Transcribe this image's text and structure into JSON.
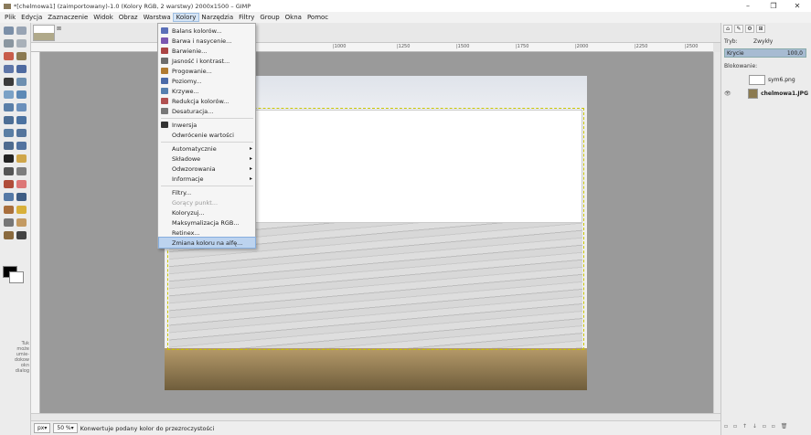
{
  "window": {
    "title": "*[chelmowa1] (zaimportowany)-1.0 (Kolory RGB, 2 warstwy) 2000x1500 – GIMP",
    "minimize": "–",
    "maximize": "❐",
    "close": "✕"
  },
  "menubar": [
    "Plik",
    "Edycja",
    "Zaznaczenie",
    "Widok",
    "Obraz",
    "Warstwa",
    "Kolory",
    "Narzędzia",
    "Filtry",
    "Group",
    "Okna",
    "Pomoc"
  ],
  "kolory_menu": [
    {
      "label": "Balans kolorów...",
      "icon": "color-balance-icon",
      "color": "#5a6fb8"
    },
    {
      "label": "Barwa i nasycenie...",
      "icon": "hue-saturation-icon",
      "color": "#7a56b0"
    },
    {
      "label": "Barwienie...",
      "icon": "colorize-icon",
      "color": "#a44"
    },
    {
      "label": "Jasność i kontrast...",
      "icon": "brightness-contrast-icon",
      "color": "#6c6c6c"
    },
    {
      "label": "Progowanie...",
      "icon": "threshold-icon",
      "color": "#b07a30"
    },
    {
      "label": "Poziomy...",
      "icon": "levels-icon",
      "color": "#4a6aa8"
    },
    {
      "label": "Krzywe...",
      "icon": "curves-icon",
      "color": "#5580b0"
    },
    {
      "label": "Redukcja kolorów...",
      "icon": "posterize-icon",
      "color": "#b05050"
    },
    {
      "label": "Desaturacja...",
      "icon": "desaturate-icon",
      "color": "#777"
    },
    {
      "label": "Inwersja",
      "icon": "invert-icon",
      "color": "#333"
    },
    {
      "label": "Odwrócenie wartości",
      "icon": "",
      "color": ""
    },
    {
      "label": "Automatycznie",
      "icon": "",
      "color": "",
      "submenu": true
    },
    {
      "label": "Składowe",
      "icon": "",
      "color": "",
      "submenu": true
    },
    {
      "label": "Odwzorowania",
      "icon": "",
      "color": "",
      "submenu": true
    },
    {
      "label": "Informacje",
      "icon": "",
      "color": "",
      "submenu": true
    },
    {
      "label": "Filtry...",
      "icon": "",
      "color": ""
    },
    {
      "label": "Gorący punkt...",
      "icon": "",
      "color": "",
      "disabled": true
    },
    {
      "label": "Koloryzuj...",
      "icon": "",
      "color": ""
    },
    {
      "label": "Maksymalizacja RGB...",
      "icon": "",
      "color": ""
    },
    {
      "label": "Retinex...",
      "icon": "",
      "color": ""
    },
    {
      "label": "Zmiana koloru na alfę...",
      "icon": "",
      "color": "",
      "highlighted": true
    }
  ],
  "tab": {
    "close": "⊠"
  },
  "ruler": {
    "ticks": [
      "|1000",
      "|1250",
      "|1500",
      "|1750",
      "|2000",
      "|2250",
      "|2500"
    ]
  },
  "toolbox": {
    "hint": "Tuk\nmoże\numie-\ndokow\nokn\ndialog"
  },
  "status": {
    "unit": "px",
    "zoom": "50 %",
    "message": "Konwertuje podany kolor do przezroczystości"
  },
  "dock": {
    "mode_label": "Tryb:",
    "mode_value": "Zwykły",
    "opacity_label": "Krycie",
    "opacity_value": "100,0",
    "lock_label": "Blokowanie:",
    "layers": [
      {
        "name": "sym6.png"
      },
      {
        "name": "chelmowa1.JPG"
      }
    ],
    "tabs": [
      "⌂",
      "✎",
      "⚙",
      "⊞"
    ]
  }
}
